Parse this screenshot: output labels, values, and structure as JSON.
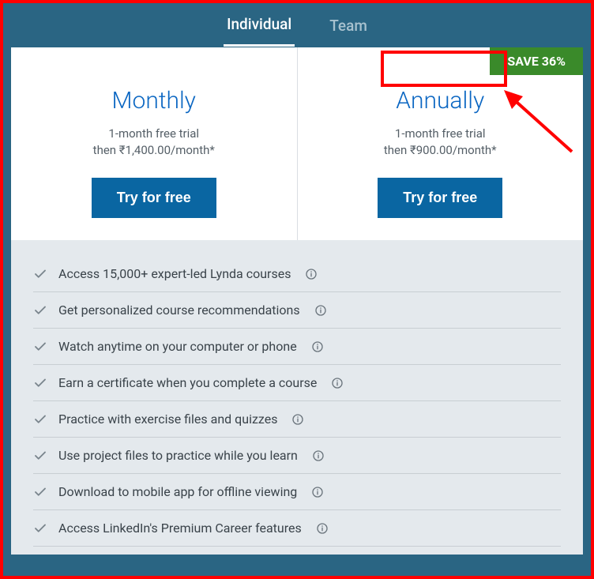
{
  "tabs": {
    "individual": "Individual",
    "team": "Team"
  },
  "plans": {
    "monthly": {
      "title": "Monthly",
      "trial": "1-month free trial",
      "price": "then ₹1,400.00/month*",
      "cta": "Try for free"
    },
    "annually": {
      "title": "Annually",
      "trial": "1-month free trial",
      "price": "then ₹900.00/month*",
      "cta": "Try for free",
      "badge": "SAVE 36%"
    }
  },
  "features": [
    "Access 15,000+ expert-led Lynda courses",
    "Get personalized course recommendations",
    "Watch anytime on your computer or phone",
    "Earn a certificate when you complete a course",
    "Practice with exercise files and quizzes",
    "Use project files to practice while you learn",
    "Download to mobile app for offline viewing",
    "Access LinkedIn's Premium Career features"
  ]
}
